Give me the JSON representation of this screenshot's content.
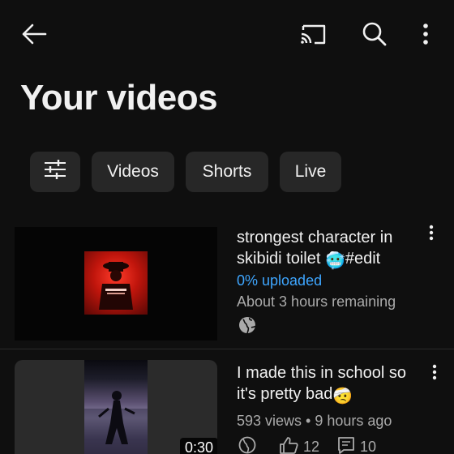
{
  "header": {
    "title": "Your videos",
    "icons": [
      "back-arrow-icon",
      "cast-icon",
      "search-icon",
      "more-vert-icon"
    ]
  },
  "chips": [
    {
      "icon": "filter-sliders-icon"
    },
    {
      "label": "Videos"
    },
    {
      "label": "Shorts"
    },
    {
      "label": "Live"
    }
  ],
  "videos": [
    {
      "title_line1": "strongest character in",
      "title_line2": "skibidi toilet",
      "title_emoji": "🥶",
      "title_tag": "#edit",
      "status": "0% uploaded",
      "remaining": "About 3 hours remaining",
      "visibility_icon": "globe-icon"
    },
    {
      "title_line1": "I made this in school so",
      "title_line2": "it's pretty bad",
      "title_emoji": "🤕",
      "duration": "0:30",
      "meta": "593 views • 9 hours ago",
      "likes": "12",
      "comments": "10"
    }
  ],
  "colors": {
    "background": "#0f0f0f",
    "chip": "#272727",
    "link_blue": "#3ea6ff",
    "secondary_text": "#aaaaaa"
  }
}
